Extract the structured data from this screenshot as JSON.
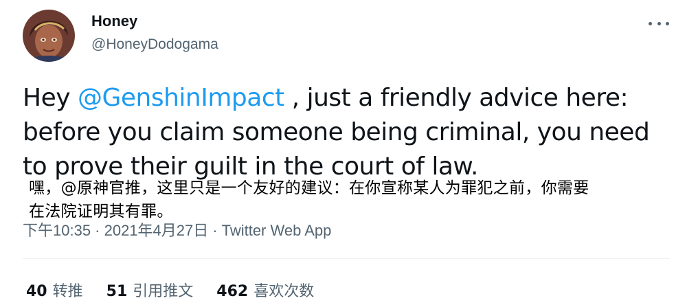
{
  "author": {
    "display_name": "Honey",
    "handle": "@HoneyDodogama"
  },
  "tweet": {
    "prefix": "Hey ",
    "mention": "@GenshinImpact",
    "suffix": " , just a friendly advice here: before you claim someone being criminal, you need to prove their guilt in the court of law."
  },
  "translation": {
    "line1": "嘿，@原神官推，这里只是一个友好的建议：在你宣称某人为罪犯之前，你需要",
    "line2": "在法院证明其有罪。"
  },
  "meta": {
    "timestamp": "下午10:35 · 2021年4月27日",
    "separator": "·",
    "source": "Twitter Web App"
  },
  "stats": {
    "retweets": {
      "count": "40",
      "label": "转推"
    },
    "quotes": {
      "count": "51",
      "label": "引用推文"
    },
    "likes": {
      "count": "462",
      "label": "喜欢次数"
    }
  },
  "colors": {
    "link": "#1d9bf0",
    "secondary_text": "#536471",
    "primary_text": "#0f1419"
  },
  "icons": {
    "more": "more-horizontal-icon",
    "avatar": "avatar-portrait"
  }
}
